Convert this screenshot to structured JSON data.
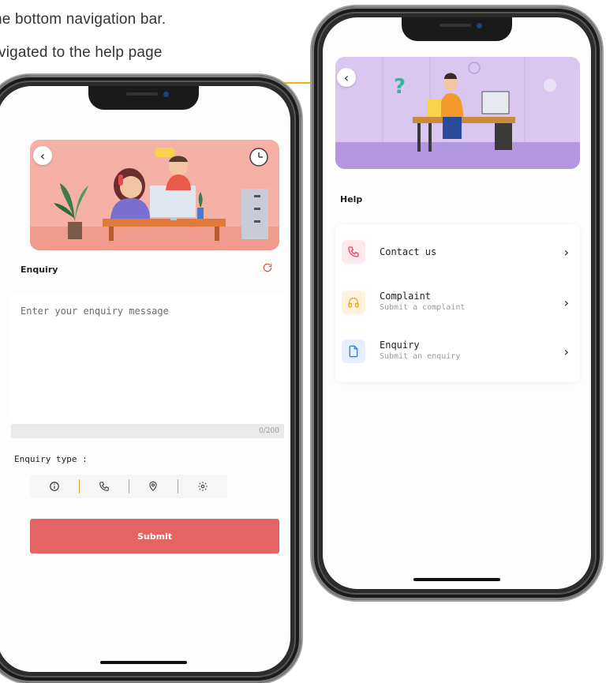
{
  "captions": {
    "line1": "he bottom navigation bar.",
    "line2": "vigated to the help page"
  },
  "enquiry_screen": {
    "back": "‹",
    "title": "Enquiry",
    "refresh_icon": "refresh-icon",
    "message_placeholder": "Enter your enquiry message",
    "counter": "0/200",
    "type_label": "Enquiry type :",
    "type_icons": [
      "info-icon",
      "phone-icon",
      "location-icon",
      "gear-icon"
    ],
    "submit": "Submit",
    "banner_color": "#f6b1a7"
  },
  "help_screen": {
    "back": "‹",
    "title": "Help",
    "banner_color": "#c9b3e8",
    "items": [
      {
        "title": "Contact us",
        "subtitle": "",
        "icon": "phone-icon",
        "icon_bg": "#fde8ec",
        "icon_color": "#e1456a"
      },
      {
        "title": "Complaint",
        "subtitle": "Submit a complaint",
        "icon": "headphones-icon",
        "icon_bg": "#fff2dd",
        "icon_color": "#f0a22a"
      },
      {
        "title": "Enquiry",
        "subtitle": "Submit an enquiry",
        "icon": "document-icon",
        "icon_bg": "#e4efff",
        "icon_color": "#3b7de0"
      }
    ]
  },
  "accent": "#f2b312"
}
